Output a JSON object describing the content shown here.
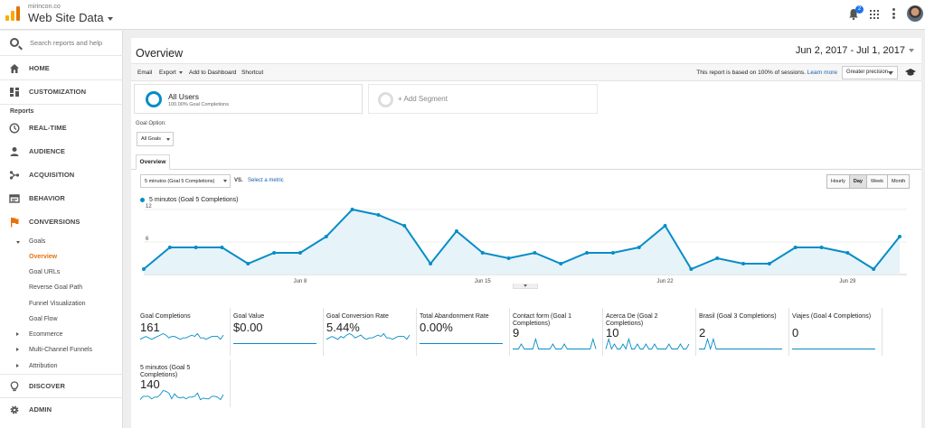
{
  "app": {
    "account": "mirincon.co",
    "property": "Web Site Data",
    "notification_count": "2",
    "accent": "#058dc7",
    "active_color": "#e8710a"
  },
  "sidebar": {
    "search_placeholder": "Search reports and help",
    "home": "HOME",
    "customization": "CUSTOMIZATION",
    "reports_header": "Reports",
    "realtime": "REAL-TIME",
    "audience": "AUDIENCE",
    "acquisition": "ACQUISITION",
    "behavior": "BEHAVIOR",
    "conversions": "CONVERSIONS",
    "goals": "Goals",
    "goals_sub": [
      "Overview",
      "Goal URLs",
      "Reverse Goal Path",
      "Funnel Visualization",
      "Goal Flow"
    ],
    "ecommerce": "Ecommerce",
    "multichannel": "Multi-Channel Funnels",
    "attribution": "Attribution",
    "discover": "DISCOVER",
    "admin": "ADMIN"
  },
  "header": {
    "title": "Overview",
    "date_range": "Jun 2, 2017 - Jul 1, 2017"
  },
  "toolbar": {
    "email": "Email",
    "export": "Export",
    "add_dashboard": "Add to Dashboard",
    "shortcut": "Shortcut",
    "sessions_note": "This report is based on 100% of sessions.",
    "learn_more": "Learn more",
    "precision": "Greater precision"
  },
  "segments": {
    "active_title": "All Users",
    "active_sub": "100.00% Goal Completions",
    "add_label": "+ Add Segment"
  },
  "goal_option": {
    "label": "Goal Option:",
    "value": "All Goals"
  },
  "tabs": {
    "overview": "Overview"
  },
  "metric": {
    "selected": "5 minutos (Goal 5 Completions)",
    "vs": "VS.",
    "select_metric": "Select a metric"
  },
  "granularity": [
    "Hourly",
    "Day",
    "Week",
    "Month"
  ],
  "chart_data": {
    "type": "area",
    "series": [
      {
        "name": "5 minutos (Goal 5 Completions)",
        "values": [
          1,
          5,
          5,
          5,
          2,
          4,
          4,
          7,
          12,
          11,
          9,
          2,
          8,
          4,
          3,
          4,
          2,
          4,
          4,
          5,
          9,
          1,
          3,
          2,
          2,
          5,
          5,
          4,
          1,
          7
        ]
      }
    ],
    "x": [
      "Jun 2",
      "Jun 3",
      "Jun 4",
      "Jun 5",
      "Jun 6",
      "Jun 7",
      "Jun 8",
      "Jun 9",
      "Jun 10",
      "Jun 11",
      "Jun 12",
      "Jun 13",
      "Jun 14",
      "Jun 15",
      "Jun 16",
      "Jun 17",
      "Jun 18",
      "Jun 19",
      "Jun 20",
      "Jun 21",
      "Jun 22",
      "Jun 23",
      "Jun 24",
      "Jun 25",
      "Jun 26",
      "Jun 27",
      "Jun 28",
      "Jun 29",
      "Jun 30",
      "Jul 1"
    ],
    "x_tick_labels": [
      "Jun 8",
      "Jun 15",
      "Jun 22",
      "Jun 29"
    ],
    "y_tick_labels": [
      "6",
      "12"
    ],
    "ylim": [
      0,
      12.5
    ],
    "grid": true,
    "color": "#058dc7"
  },
  "tiles": [
    {
      "label": "Goal Completions",
      "value": "161",
      "spark": [
        3,
        4,
        5,
        4,
        3,
        4,
        5,
        6,
        7,
        6,
        4,
        5,
        5,
        4,
        3,
        4,
        4,
        5,
        6,
        5,
        7,
        4,
        4,
        3,
        4,
        5,
        5,
        5,
        3,
        6
      ]
    },
    {
      "label": "Goal Value",
      "value": "$0.00",
      "spark": []
    },
    {
      "label": "Goal Conversion Rate",
      "value": "5.44%",
      "spark": [
        3,
        4,
        5,
        4,
        3,
        5,
        4,
        6,
        7,
        6,
        4,
        5,
        6,
        4,
        3,
        4,
        4,
        5,
        6,
        5,
        7,
        4,
        4,
        3,
        4,
        5,
        5,
        5,
        3,
        6
      ]
    },
    {
      "label": "Total Abandonment Rate",
      "value": "0.00%",
      "spark": []
    },
    {
      "label": "Contact form (Goal 1 Completions)",
      "value": "9",
      "spark": [
        0,
        0,
        0,
        1,
        0,
        0,
        0,
        0,
        2,
        0,
        0,
        0,
        0,
        0,
        1,
        0,
        0,
        0,
        1,
        0,
        0,
        0,
        0,
        0,
        0,
        0,
        0,
        0,
        2,
        0
      ]
    },
    {
      "label": "Acerca De (Goal 2 Completions)",
      "value": "10",
      "spark": [
        0,
        2,
        0,
        1,
        0,
        0,
        1,
        0,
        2,
        0,
        0,
        1,
        0,
        0,
        1,
        0,
        0,
        1,
        0,
        0,
        0,
        0,
        1,
        0,
        0,
        0,
        1,
        0,
        0,
        1
      ]
    },
    {
      "label": "Brasil (Goal 3 Completions)",
      "value": "2",
      "spark": [
        0,
        0,
        0,
        2,
        0,
        2,
        0,
        0,
        0,
        0,
        0,
        0,
        0,
        0,
        0,
        0,
        0,
        0,
        0,
        0,
        0,
        0,
        0,
        0,
        0,
        0,
        0,
        0,
        0,
        0
      ]
    },
    {
      "label": "Viajes (Goal 4 Completions)",
      "value": "0",
      "spark": []
    },
    {
      "label": "5 minutos (Goal 5 Completions)",
      "value": "140",
      "spark": [
        1,
        5,
        5,
        5,
        2,
        4,
        4,
        7,
        12,
        11,
        9,
        2,
        8,
        4,
        3,
        4,
        2,
        4,
        4,
        5,
        9,
        1,
        3,
        2,
        2,
        5,
        5,
        4,
        1,
        7
      ]
    }
  ]
}
